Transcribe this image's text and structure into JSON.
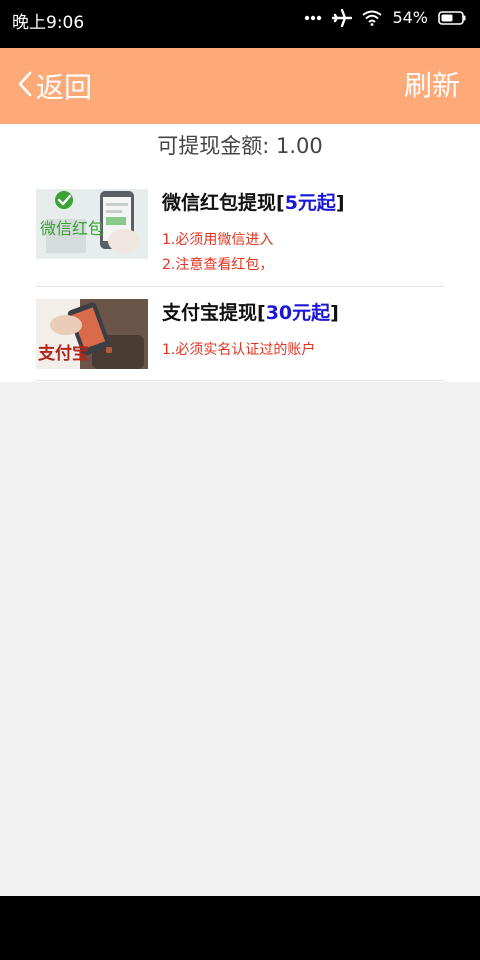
{
  "status_bar": {
    "time": "晚上9:06",
    "battery": "54%",
    "icons": [
      "more-dots-icon",
      "airplane-icon",
      "wifi-icon",
      "battery-icon"
    ]
  },
  "header": {
    "back_label": "返回",
    "refresh_label": "刷新",
    "background": "#fdaa78"
  },
  "balance": {
    "label": "可提现金额:",
    "value": "1.00"
  },
  "options": [
    {
      "title_prefix": "微信红包提现[",
      "amount": "5元起",
      "title_suffix": "]",
      "thumb_text": "微信红包",
      "rules": [
        "1.必须用微信进入",
        "2.注意查看红包，"
      ]
    },
    {
      "title_prefix": "支付宝提现[",
      "amount": "30元起",
      "title_suffix": "]",
      "thumb_text": "支付宝",
      "rules": [
        "1.必须实名认证过的账户"
      ]
    }
  ],
  "colors": {
    "accent": "#fdaa78",
    "amount": "#1a17d6",
    "rule_text": "#e3341f",
    "page_bg": "#f1f1f1"
  }
}
